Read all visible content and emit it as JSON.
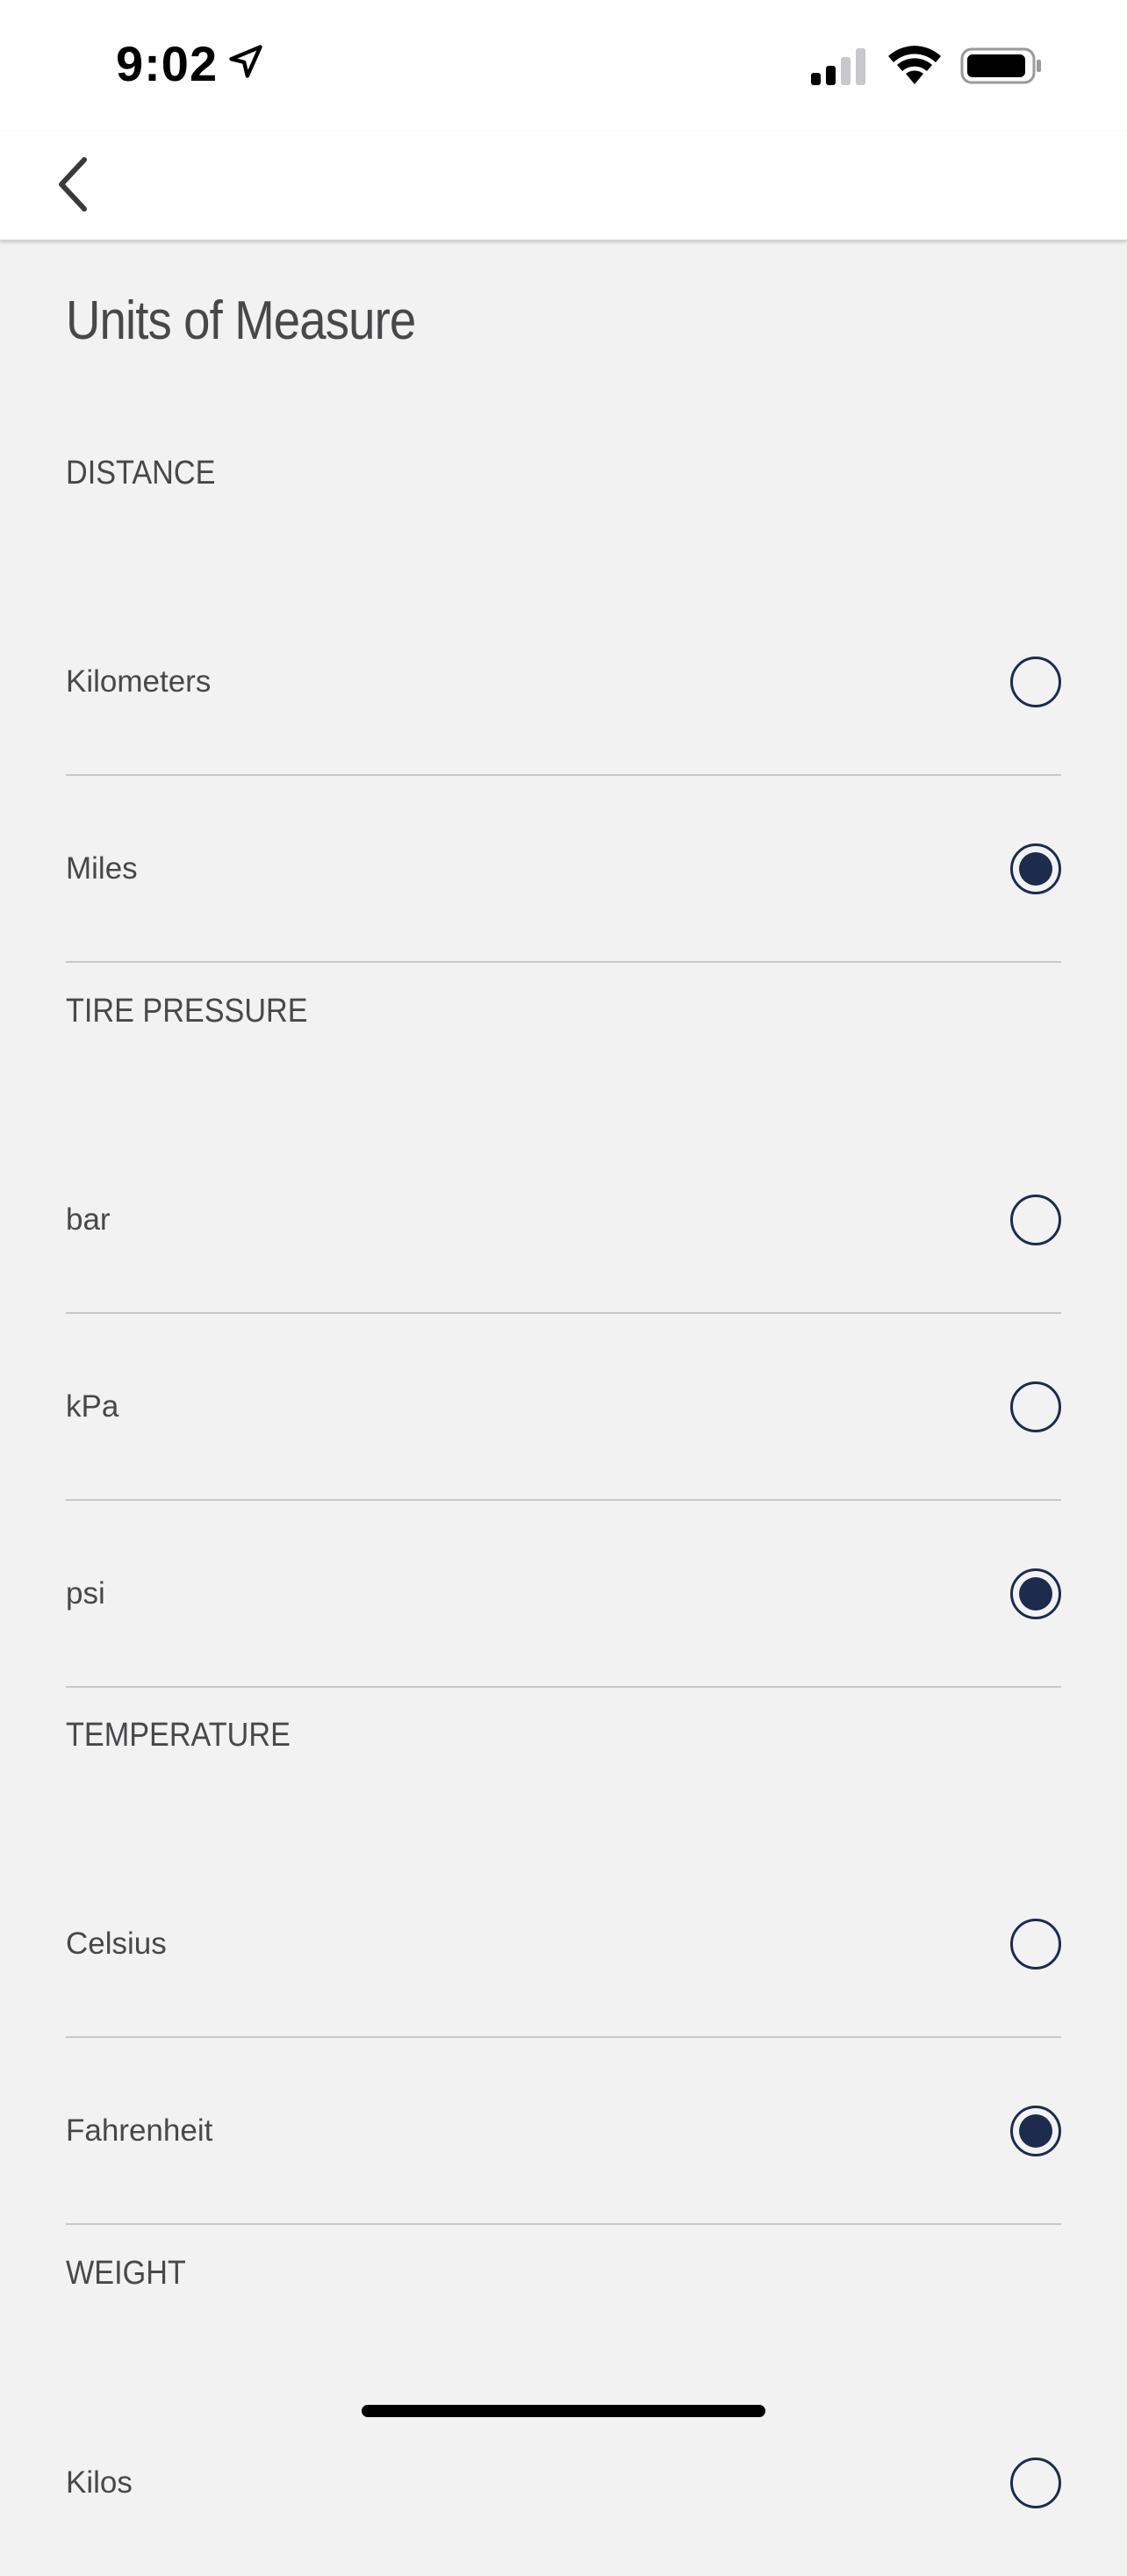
{
  "status_bar": {
    "time": "9:02"
  },
  "page": {
    "title": "Units of Measure"
  },
  "colors": {
    "radio_accent": "#1d2b4d",
    "background": "#f2f2f3"
  },
  "sections": [
    {
      "header": "DISTANCE",
      "options": [
        {
          "label": "Kilometers",
          "selected": false
        },
        {
          "label": "Miles",
          "selected": true
        }
      ]
    },
    {
      "header": "TIRE PRESSURE",
      "options": [
        {
          "label": "bar",
          "selected": false
        },
        {
          "label": "kPa",
          "selected": false
        },
        {
          "label": "psi",
          "selected": true
        }
      ]
    },
    {
      "header": "TEMPERATURE",
      "options": [
        {
          "label": "Celsius",
          "selected": false
        },
        {
          "label": "Fahrenheit",
          "selected": true
        }
      ]
    },
    {
      "header": "WEIGHT",
      "options": [
        {
          "label": "Kilos",
          "selected": false
        }
      ]
    }
  ]
}
